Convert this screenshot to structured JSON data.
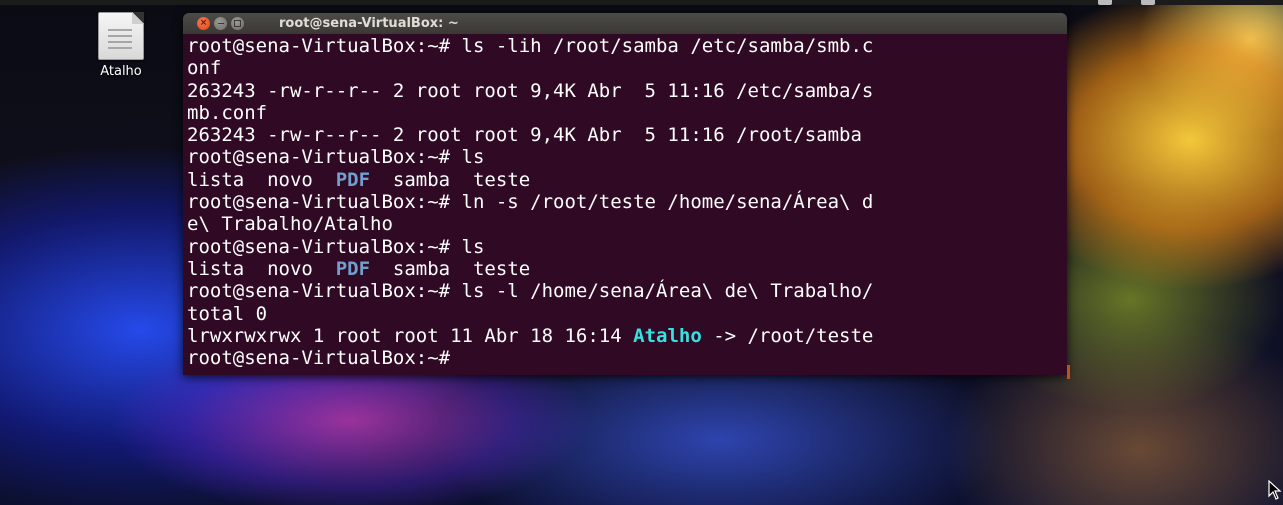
{
  "desktop": {
    "icons": [
      {
        "label": "Atalho",
        "icon": "text-file-icon"
      }
    ]
  },
  "terminal": {
    "title": "root@sena-VirtualBox: ~",
    "lines": [
      {
        "text": "root@sena-VirtualBox:~# ls -lih /root/samba /etc/samba/smb.c"
      },
      {
        "text": "onf"
      },
      {
        "text": "263243 -rw-r--r-- 2 root root 9,4K Abr  5 11:16 /etc/samba/s"
      },
      {
        "text": "mb.conf"
      },
      {
        "text": "263243 -rw-r--r-- 2 root root 9,4K Abr  5 11:16 /root/samba"
      },
      {
        "text": "root@sena-VirtualBox:~# ls"
      },
      {
        "segments": [
          {
            "text": "lista  novo  ",
            "style": "plain"
          },
          {
            "text": "PDF",
            "style": "dir"
          },
          {
            "text": "  samba  teste",
            "style": "plain"
          }
        ]
      },
      {
        "text": "root@sena-VirtualBox:~# ln -s /root/teste /home/sena/Área\\ d"
      },
      {
        "text": "e\\ Trabalho/Atalho"
      },
      {
        "text": "root@sena-VirtualBox:~# ls"
      },
      {
        "segments": [
          {
            "text": "lista  novo  ",
            "style": "plain"
          },
          {
            "text": "PDF",
            "style": "dir"
          },
          {
            "text": "  samba  teste",
            "style": "plain"
          }
        ]
      },
      {
        "text": "root@sena-VirtualBox:~# ls -l /home/sena/Área\\ de\\ Trabalho/"
      },
      {
        "text": "total 0"
      },
      {
        "segments": [
          {
            "text": "lrwxrwxrwx 1 root root 11 Abr 18 16:14 ",
            "style": "plain"
          },
          {
            "text": "Atalho",
            "style": "link"
          },
          {
            "text": " -> /root/teste",
            "style": "plain"
          }
        ]
      },
      {
        "text": "root@sena-VirtualBox:~# "
      }
    ]
  },
  "colors": {
    "terminal_bg": "#300a24",
    "terminal_fg": "#ffffff",
    "dir_color": "#729fcf",
    "symlink_color": "#34e2e2",
    "close_button": "#e2441a"
  }
}
